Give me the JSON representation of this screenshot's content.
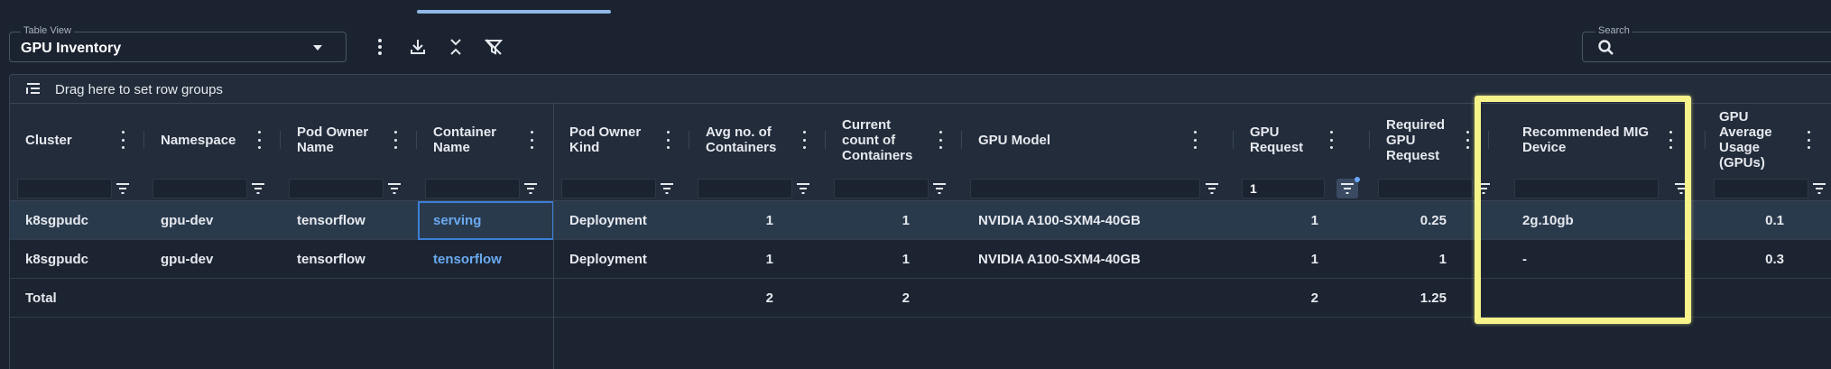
{
  "table_view": {
    "label": "Table View",
    "value": "GPU Inventory"
  },
  "toolbar": {
    "more_icon": "more-vertical-icon",
    "download_icon": "download-icon",
    "collapse_icon": "collapse-icon",
    "clear_filter_icon": "filter-off-icon"
  },
  "search": {
    "label": "Search",
    "placeholder": ""
  },
  "grid": {
    "group_panel_text": "Drag here to set row groups",
    "columns": [
      {
        "key": "cluster",
        "label": "Cluster"
      },
      {
        "key": "namespace",
        "label": "Namespace"
      },
      {
        "key": "pod_owner_name",
        "label": "Pod Owner Name"
      },
      {
        "key": "container_name",
        "label": "Container Name"
      },
      {
        "key": "pod_owner_kind",
        "label": "Pod Owner Kind"
      },
      {
        "key": "avg_containers",
        "label": "Avg no. of Containers"
      },
      {
        "key": "current_containers",
        "label": "Current count of Containers"
      },
      {
        "key": "gpu_model",
        "label": "GPU Model"
      },
      {
        "key": "gpu_request",
        "label": "GPU Request"
      },
      {
        "key": "required_gpu_request",
        "label": "Required GPU Request"
      },
      {
        "key": "recommended_mig",
        "label": "Recommended MIG Device"
      },
      {
        "key": "gpu_avg_usage",
        "label": "GPU Average Usage (GPUs)"
      }
    ],
    "filters": {
      "gpu_request": "1"
    },
    "rows": [
      {
        "cluster": "k8sgpudc",
        "namespace": "gpu-dev",
        "pod_owner_name": "tensorflow",
        "container_name": "serving",
        "pod_owner_kind": "Deployment",
        "avg_containers": "1",
        "current_containers": "1",
        "gpu_model": "NVIDIA A100-SXM4-40GB",
        "gpu_request": "1",
        "required_gpu_request": "0.25",
        "recommended_mig": "2g.10gb",
        "gpu_avg_usage": "0.1"
      },
      {
        "cluster": "k8sgpudc",
        "namespace": "gpu-dev",
        "pod_owner_name": "tensorflow",
        "container_name": "tensorflow",
        "pod_owner_kind": "Deployment",
        "avg_containers": "1",
        "current_containers": "1",
        "gpu_model": "NVIDIA A100-SXM4-40GB",
        "gpu_request": "1",
        "required_gpu_request": "1",
        "recommended_mig": "-",
        "gpu_avg_usage": "0.3"
      }
    ],
    "total": {
      "label": "Total",
      "avg_containers": "2",
      "current_containers": "2",
      "gpu_request": "2",
      "required_gpu_request": "1.25"
    }
  },
  "colors": {
    "background": "#1b2330",
    "link": "#6aaaf0",
    "highlight": "#f6f38a",
    "selected_row": "#2a3a4d"
  }
}
